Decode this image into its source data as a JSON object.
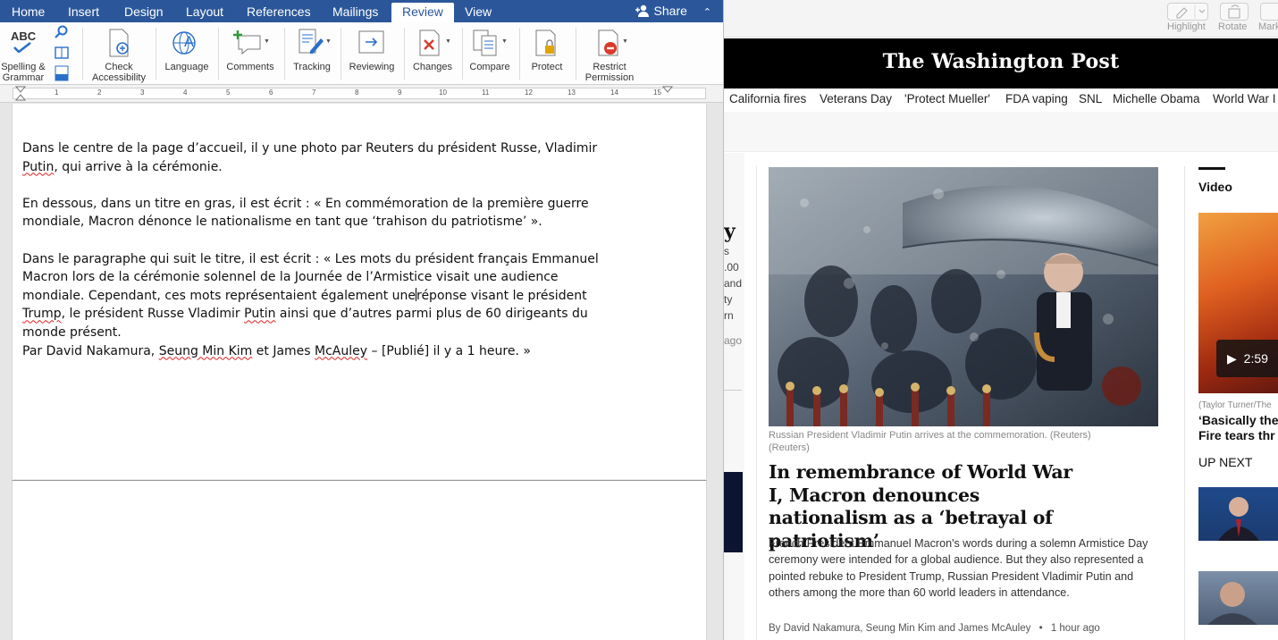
{
  "word": {
    "tabs": [
      "Home",
      "Insert",
      "Design",
      "Layout",
      "References",
      "Mailings",
      "Review",
      "View"
    ],
    "active_tab": "Review",
    "share_label": "Share",
    "ribbon": {
      "spelling_label_1": "Spelling &",
      "spelling_label_2": "Grammar",
      "abc_text": "ABC",
      "check_accessibility_1": "Check",
      "check_accessibility_2": "Accessibility",
      "language": "Language",
      "comments": "Comments",
      "tracking": "Tracking",
      "reviewing": "Reviewing",
      "changes": "Changes",
      "compare": "Compare",
      "protect": "Protect",
      "restrict_1": "Restrict",
      "restrict_2": "Permission"
    },
    "ruler_numbers": [
      "1",
      "2",
      "3",
      "4",
      "5",
      "6",
      "7",
      "8",
      "9",
      "10",
      "11",
      "12",
      "13",
      "14",
      "15"
    ],
    "document": {
      "p1_a": "Dans le centre de la page d’accueil, il y une photo par Reuters du président Russe, Vladimir",
      "p1_b_sq": "Putin",
      "p1_b": ", qui arrive à la cérémonie.",
      "p2_a": "En dessous, dans un titre en gras, il est écrit : « En commémoration de la première guerre",
      "p2_b": "mondiale, Macron dénonce le nationalisme en tant que ‘trahison du patriotisme’ ».",
      "p3_a": "Dans le paragraphe qui suit le titre, il est écrit : « Les mots du président français Emmanuel",
      "p3_b": "Macron lors de la cérémonie solennel de la Journée de l’Armistice visait une audience",
      "p3_c1": "mondiale. Cependant, ces mots représentaient également une",
      "p3_c2": "réponse visant le président",
      "p3_d_sq1": "Trump",
      "p3_d1": ", le président Russe Vladimir ",
      "p3_d_sq2": "Putin",
      "p3_d2": " ainsi que d’autres parmi plus de 60 dirigeants du",
      "p3_e": "monde présent.",
      "p4_a": "Par David Nakamura, ",
      "p4_sq1": "Seung Min Kim",
      "p4_b": " et James ",
      "p4_sq2": "McAuley",
      "p4_c": " – [Publié] il y a 1 heure. »"
    }
  },
  "browser": {
    "toolbar": {
      "highlight": "Highlight",
      "rotate": "Rotate",
      "markup": "Mark"
    },
    "masthead": "The Washington Post",
    "nav": [
      "California fires",
      "Veterans Day",
      "'Protect Mueller'",
      "FDA vaping",
      "SNL",
      "Michelle Obama",
      "World War I"
    ],
    "peek": {
      "big": "y",
      "lines": [
        "s",
        ".00",
        "and",
        "ty",
        "rn"
      ],
      "ago": "ago"
    },
    "photo_caption_1": "Russian President Vladimir Putin arrives at the commemoration. (Reuters)",
    "photo_caption_2": "(Reuters)",
    "headline": "In remembrance of World War I, Macron denounces nationalism as a ‘betrayal of patriotism’",
    "blurb": "French President Emmanuel Macron's words during a solemn Armistice Day ceremony were intended for a global audience. But they also represented a pointed rebuke to President Trump, Russian President Vladimir Putin and others among the more than 60 world leaders in attendance.",
    "byline": "By David Nakamura, Seung Min Kim and James McAuley",
    "byline_dot": "•",
    "time_ago": "1 hour ago",
    "video_label": "Video",
    "video_duration": "2:59",
    "video_credit": "(Taylor Turner/The",
    "video_title_1": "‘Basically the",
    "video_title_2": "Fire tears thr",
    "up_next": "UP NEXT"
  },
  "colors": {
    "word_blue": "#2b579a",
    "wp_black": "#000000",
    "squiggle_red": "#dd2222"
  }
}
